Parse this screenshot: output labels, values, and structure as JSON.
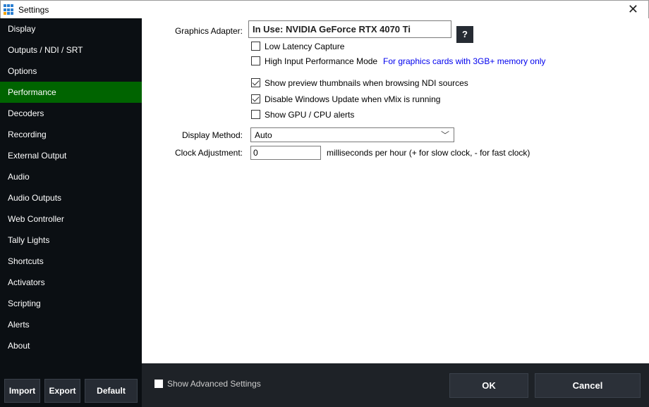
{
  "window": {
    "title": "Settings",
    "close": "✕"
  },
  "sidebar": {
    "items": [
      {
        "label": "Display"
      },
      {
        "label": "Outputs / NDI / SRT"
      },
      {
        "label": "Options"
      },
      {
        "label": "Performance",
        "selected": true
      },
      {
        "label": "Decoders"
      },
      {
        "label": "Recording"
      },
      {
        "label": "External Output"
      },
      {
        "label": "Audio"
      },
      {
        "label": "Audio Outputs"
      },
      {
        "label": "Web Controller"
      },
      {
        "label": "Tally Lights"
      },
      {
        "label": "Shortcuts"
      },
      {
        "label": "Activators"
      },
      {
        "label": "Scripting"
      },
      {
        "label": "Alerts"
      },
      {
        "label": "About"
      }
    ],
    "import_label": "Import",
    "export_label": "Export",
    "default_label": "Default",
    "selected_color": "#006400"
  },
  "main": {
    "graphics_adapter_label": "Graphics Adapter:",
    "graphics_adapter_value": "In Use: NVIDIA GeForce RTX 4070 Ti",
    "help_label": "?",
    "checkboxes": [
      {
        "label": "Low Latency Capture",
        "checked": false
      },
      {
        "label": "High Input Performance Mode",
        "checked": false
      },
      {
        "label": "Show preview thumbnails when browsing NDI sources",
        "checked": true
      },
      {
        "label": "Disable Windows Update when vMix is running",
        "checked": true
      },
      {
        "label": "Show GPU / CPU alerts",
        "checked": false
      }
    ],
    "high_input_note": "For graphics cards with 3GB+ memory only",
    "display_method_label": "Display Method:",
    "display_method_value": "Auto",
    "clock_label": "Clock Adjustment:",
    "clock_value": "0",
    "clock_hint": "milliseconds per hour (+ for slow clock, - for fast clock)"
  },
  "footer": {
    "show_advanced_label": "Show Advanced Settings",
    "show_advanced_checked": false,
    "ok_label": "OK",
    "cancel_label": "Cancel"
  }
}
